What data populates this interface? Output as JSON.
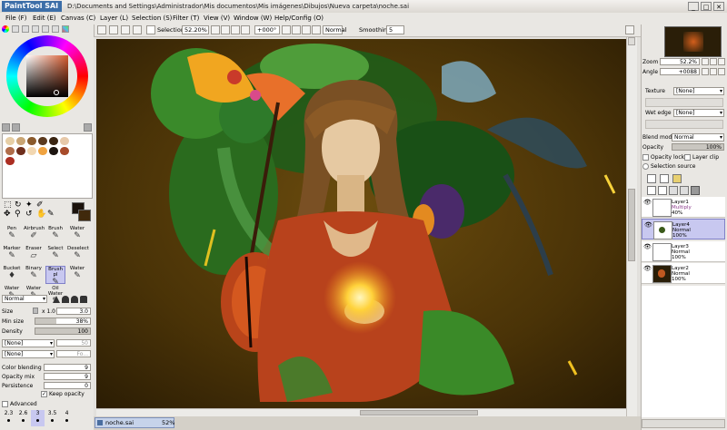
{
  "app": {
    "logo": "PaintTool SAI",
    "title": "D:\\Documents and Settings\\Administrador\\Mis documentos\\Mis imágenes\\Dibujos\\Nueva carpeta\\noche.sai"
  },
  "menu": [
    "File (F)",
    "Edit (E)",
    "Canvas (C)",
    "Layer (L)",
    "Selection (S)",
    "Filter (T)",
    "View (V)",
    "Window (W)",
    "Help/Config (O)"
  ],
  "toolbar": {
    "selection_label": "Selection",
    "zoom": "52.20%",
    "angle": "+000°",
    "blend": "Normal",
    "smoothing_label": "Smoothing",
    "smoothing_value": "5"
  },
  "left": {
    "tools": [
      {
        "label": "Pen",
        "icon": "pen-icon",
        "glyph": "✎"
      },
      {
        "label": "Airbrush",
        "icon": "airbrush-icon",
        "glyph": "✐"
      },
      {
        "label": "Brush",
        "icon": "brush-icon",
        "glyph": "✎"
      },
      {
        "label": "Water",
        "icon": "water-icon",
        "glyph": "✎"
      },
      {
        "label": "Marker",
        "icon": "marker-icon",
        "glyph": "✎"
      },
      {
        "label": "Eraser",
        "icon": "eraser-icon",
        "glyph": "▱"
      },
      {
        "label": "Select",
        "icon": "select-icon",
        "glyph": "✎"
      },
      {
        "label": "Deselect",
        "icon": "deselect-icon",
        "glyph": "✎"
      },
      {
        "label": "Bucket",
        "icon": "bucket-icon",
        "glyph": "♦"
      },
      {
        "label": "Binary",
        "icon": "binary-icon",
        "glyph": "✎"
      },
      {
        "label": "Brush pl",
        "icon": "brush-pl-icon",
        "glyph": "✎"
      },
      {
        "label": "Water",
        "icon": "water2-icon",
        "glyph": "✎"
      },
      {
        "label": "Water",
        "icon": "water3-icon",
        "glyph": "✎"
      },
      {
        "label": "Water",
        "icon": "water4-icon",
        "glyph": "✎"
      },
      {
        "label": "Oil Water",
        "icon": "oil-water-icon",
        "glyph": "✎"
      },
      {
        "label": "",
        "icon": "",
        "glyph": ""
      }
    ],
    "tool_sizes": [
      "9",
      "10",
      "",
      ""
    ],
    "blend_mode": "Normal",
    "size_label": "Size",
    "size_mult": "x 1.0",
    "size_value": "3.0",
    "minsize_label": "Min size",
    "minsize_value": "38%",
    "minsize_fraction": 0.38,
    "density_label": "Density",
    "density_value": "100",
    "texture1": "[None]",
    "texture1_val": "50",
    "texture2": "[None]",
    "texture2_val": "Fo...",
    "color_blending_label": "Color blending",
    "color_blending_value": "9",
    "opacity_mix_label": "Opacity mix",
    "opacity_mix_value": "9",
    "persistence_label": "Persistence",
    "persistence_value": "0",
    "advanced_label": "Advanced",
    "keep_opacity_label": "Keep opacity",
    "brush_sizes": [
      "2.3",
      "2.6",
      "3",
      "3.5",
      "4"
    ],
    "swatches": [
      "#e6cfa6",
      "#c9a574",
      "#8a5a2c",
      "#5c3a1e",
      "#3a2512",
      "#e7c9a9",
      "#b06d4a",
      "#6e2e1c",
      "#f2d7b1",
      "#f0a340",
      "#1d1510",
      "#a74b2a",
      "#ab2e22"
    ]
  },
  "right": {
    "zoom_label": "Zoom",
    "zoom_value": "52.2%",
    "angle_label": "Angle",
    "angle_value": "+0088",
    "texture_label": "Texture",
    "texture_value": "[None]",
    "wetedge_label": "Wet edge",
    "wetedge_value": "[None]",
    "blendmode_label": "Blend mode",
    "blendmode_value": "Normal",
    "opacity_label": "Opacity",
    "opacity_value": "100%",
    "opacity_lock_label": "Opacity lock",
    "layer_clip_label": "Layer clip",
    "selection_source_label": "Selection source",
    "layers": [
      {
        "name": "Layer1",
        "mode": "Multiply",
        "opacity": "40%",
        "selected": false
      },
      {
        "name": "Layer4",
        "mode": "Normal",
        "opacity": "100%",
        "selected": true
      },
      {
        "name": "Layer3",
        "mode": "Normal",
        "opacity": "100%",
        "selected": false
      },
      {
        "name": "Layer2",
        "mode": "Normal",
        "opacity": "100%",
        "selected": false
      }
    ]
  },
  "status": {
    "filename": "noche.sai",
    "zoom": "52%"
  }
}
